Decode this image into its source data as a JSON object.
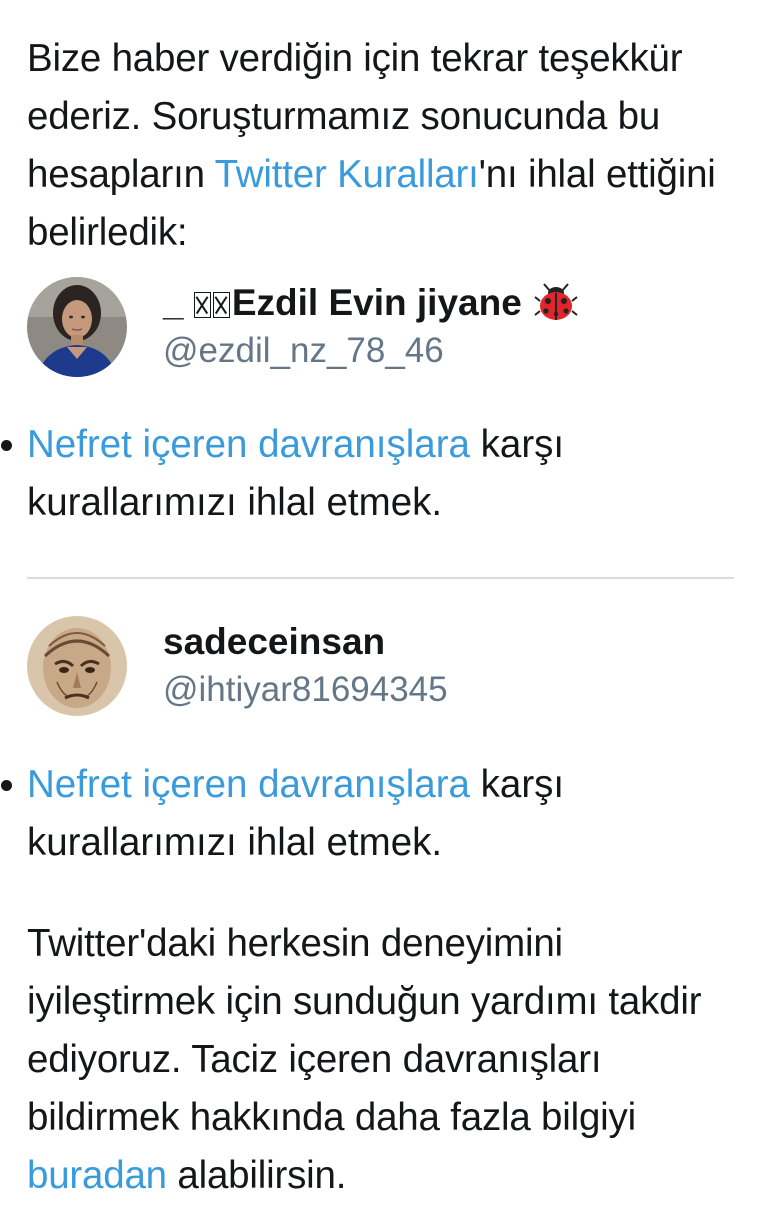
{
  "intro": {
    "text_before": "Bize haber verdiğin için tekrar teşekkür ederiz. Soruşturmamız sonucunda bu hesapların ",
    "link": "Twitter Kuralları",
    "text_after": "'nı ihlal ettiğini belirledik:"
  },
  "accounts": [
    {
      "display_name_prefix": "_ ",
      "display_name": "Ezdil Evin jiyane",
      "handle": "@ezdil_nz_78_46",
      "violation_link": "Nefret içeren davranışlara",
      "violation_text": " karşı kurallarımızı ihlal etmek."
    },
    {
      "display_name": "sadeceinsan",
      "handle": "@ihtiyar81694345",
      "violation_link": "Nefret içeren davranışlara",
      "violation_text": " karşı kurallarımızı ihlal etmek."
    }
  ],
  "outro": {
    "text_before": "Twitter'daki herkesin deneyimini iyileştirmek için sunduğun yardımı takdir ediyoruz. Taciz içeren davranışları bildirmek hakkında daha fazla bilgiyi ",
    "link": "buradan",
    "text_after": " alabilirsin."
  },
  "icons": {
    "flag_glyphs": "missing-glyph-icon",
    "emoji": "ladybug-icon"
  },
  "colors": {
    "link": "#3a9bdc",
    "text": "#14171a",
    "handle": "#657786",
    "divider": "#d9dde1"
  }
}
